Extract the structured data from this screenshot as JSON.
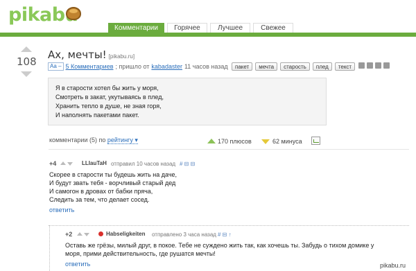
{
  "header": {
    "logo_pika": "pika",
    "logo_bu": "bu",
    "tabs": [
      {
        "label": "Комментарии"
      },
      {
        "label": "Горячее"
      },
      {
        "label": "Лучшее"
      },
      {
        "label": "Свежее"
      }
    ]
  },
  "post": {
    "rating": "108",
    "title": "Ах, мечты!",
    "source": "[pikabu.ru]",
    "font_toggle": "Аа –",
    "comments_link": "5 Комментариев",
    "came_from": "; пришло от",
    "author": "kabadaster",
    "time": "11 часов назад",
    "tags": [
      "пакет",
      "мечта",
      "старость",
      "плед",
      "текст"
    ],
    "poem": [
      "Я в старости хотел бы жить у моря,",
      "Смотреть в закат, укутываясь в плед,",
      "Хранить тепло в душе, не зная горя,",
      "И наполнять пакетами пакет."
    ]
  },
  "comments_bar": {
    "label": "комментарии (5) по",
    "sort": "рейтингу ▾",
    "plus": "170 плюсов",
    "minus": "62 минуса"
  },
  "comments": [
    {
      "score": "+4",
      "user": "LLIauTaH",
      "when": "отправил 10 часов назад",
      "icons": "# ⊟ ⊟",
      "lines": [
        "Скорее в старости ты будешь жить на даче,",
        "И будут звать тебя - ворчливый старый дед",
        "И самогон в дровах от бабки пряча,",
        "Следить за тем, что делает сосед."
      ],
      "reply": "ответить"
    },
    {
      "score": "+2",
      "user": "Habseligkeiten",
      "when": "отправлено 3 часа назад",
      "icons": "# ⊟ ↑",
      "lines": [
        "Оставь же грёзы, милый друг, в покое. Тебе не суждено жить так, как хочешь ты. Забудь о тихом домике у",
        "моря, прими действительность, где рушатся мечты!"
      ],
      "reply": "ответить"
    }
  ],
  "watermark": "pikabu.ru"
}
